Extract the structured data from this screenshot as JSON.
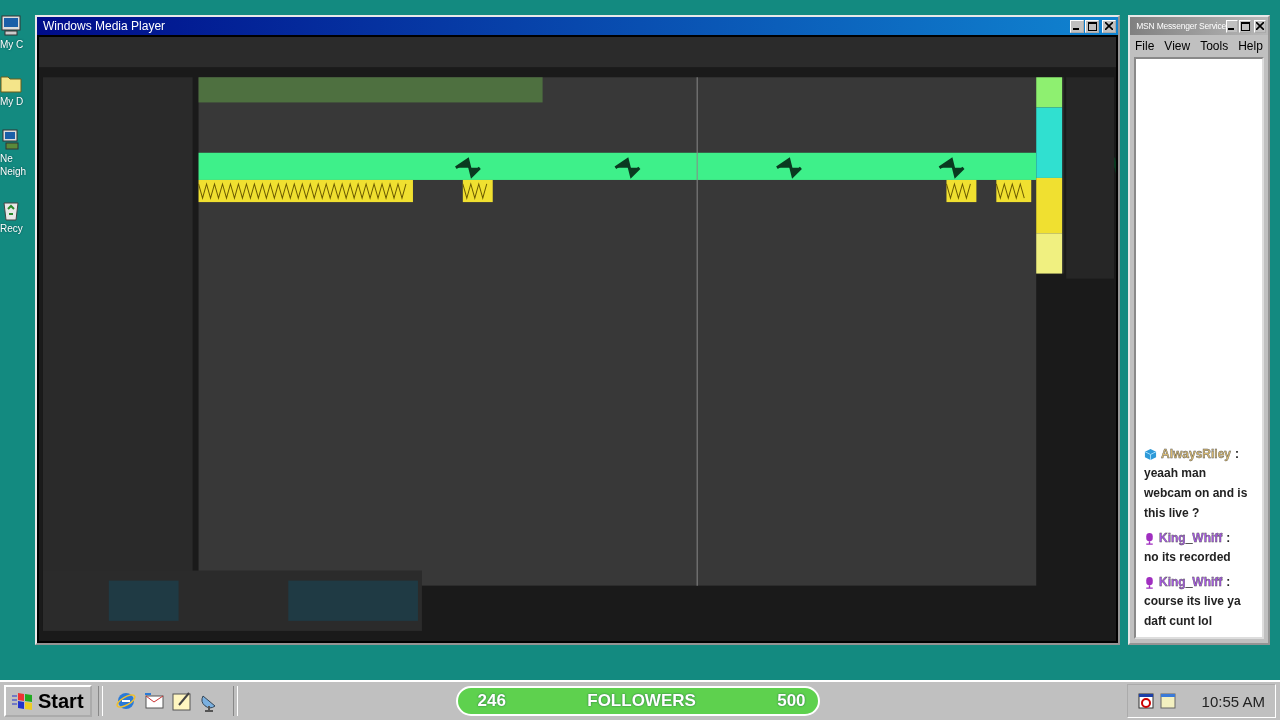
{
  "desktop": {
    "icons": [
      {
        "kind": "computer",
        "lines": [
          "My C"
        ]
      },
      {
        "kind": "folder",
        "lines": [
          "My D"
        ]
      },
      {
        "kind": "network",
        "lines": [
          "Ne",
          "Neigh"
        ]
      },
      {
        "kind": "recycle",
        "lines": [
          "Recy"
        ]
      }
    ]
  },
  "player": {
    "title": "Windows Media Player"
  },
  "messenger": {
    "title": "MSN Messenger Service",
    "menu": [
      "File",
      "View",
      "Tools",
      "Help"
    ],
    "messages": [
      {
        "user": "AlwaysRiley",
        "kind": "cube",
        "color": "#d9b96e",
        "separator": ":",
        "text": "yeaah man webcam on and is this live ?"
      },
      {
        "user": "King_Whiff",
        "kind": "mic",
        "color": "#a857e6",
        "separator": ":",
        "text": "no its recorded"
      },
      {
        "user": "King_Whiff",
        "kind": "mic",
        "color": "#a857e6",
        "separator": ":",
        "text": "course its live ya daft cunt lol"
      }
    ]
  },
  "taskbar": {
    "start": "Start",
    "quick_launch": [
      {
        "kind": "browser"
      },
      {
        "kind": "mail"
      },
      {
        "kind": "notepad"
      },
      {
        "kind": "satellite"
      }
    ],
    "followers": {
      "current": "246",
      "label": "FOLLOWERS",
      "goal": "500"
    },
    "tray": [
      {
        "kind": "calendar-clock"
      },
      {
        "kind": "notepad"
      }
    ],
    "clock": "10:55 AM"
  }
}
